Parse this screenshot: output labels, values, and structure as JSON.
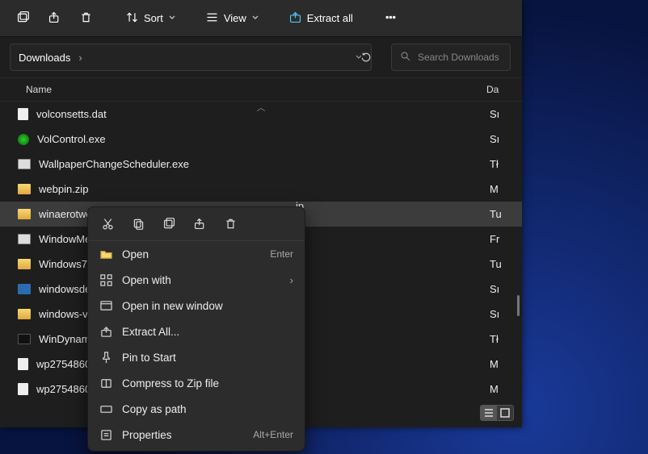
{
  "toolbar": {
    "sort_label": "Sort",
    "view_label": "View",
    "extract_label": "Extract all"
  },
  "breadcrumb": {
    "label": "Downloads"
  },
  "search": {
    "placeholder": "Search Downloads"
  },
  "columns": {
    "name": "Name",
    "date": "Da"
  },
  "files": [
    {
      "icon": "file",
      "name": "volconsetts.dat",
      "date": "Sı",
      "sel": false
    },
    {
      "icon": "exe-g",
      "name": "VolControl.exe",
      "date": "Sı",
      "sel": false
    },
    {
      "icon": "exe",
      "name": "WallpaperChangeScheduler.exe",
      "date": "Tł",
      "sel": false
    },
    {
      "icon": "zip",
      "name": "webpin.zip",
      "date": "M",
      "sel": false
    },
    {
      "icon": "zip",
      "name": "winaerotwe",
      "date": "Tu",
      "sel": true
    },
    {
      "icon": "exe",
      "name": "WindowMe",
      "date": "Fr",
      "sel": false
    },
    {
      "icon": "zip",
      "name": "Windows7G",
      "date": "Tu",
      "sel": false
    },
    {
      "icon": "exe-b",
      "name": "windowsde",
      "date": "Sı",
      "sel": false
    },
    {
      "icon": "zip",
      "name": "windows-vi",
      "date": "Sı",
      "sel": false
    },
    {
      "icon": "exe-w",
      "name": "WinDynami",
      "date": "Tł",
      "sel": false
    },
    {
      "icon": "file",
      "name": "wp2754860-",
      "date": "M",
      "sel": false
    },
    {
      "icon": "file",
      "name": "wp2754860-",
      "date": "M",
      "sel": false
    }
  ],
  "ext_fragment": "ip",
  "context_menu": {
    "items": [
      {
        "icon": "folder",
        "label": "Open",
        "accel": "Enter",
        "sub": false
      },
      {
        "icon": "grid",
        "label": "Open with",
        "accel": "",
        "sub": true
      },
      {
        "icon": "window",
        "label": "Open in new window",
        "accel": "",
        "sub": false
      },
      {
        "icon": "extract",
        "label": "Extract All...",
        "accel": "",
        "sub": false
      },
      {
        "icon": "pin",
        "label": "Pin to Start",
        "accel": "",
        "sub": false
      },
      {
        "icon": "zip",
        "label": "Compress to Zip file",
        "accel": "",
        "sub": false
      },
      {
        "icon": "path",
        "label": "Copy as path",
        "accel": "",
        "sub": false
      },
      {
        "icon": "props",
        "label": "Properties",
        "accel": "Alt+Enter",
        "sub": false
      }
    ]
  }
}
